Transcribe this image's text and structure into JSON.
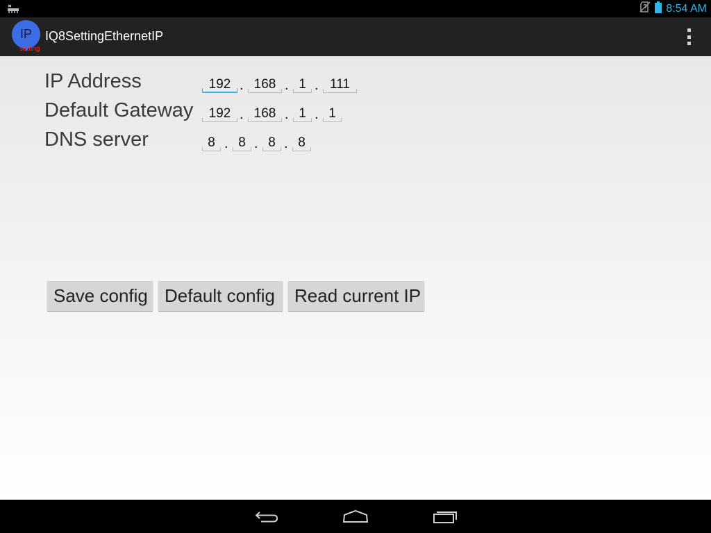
{
  "status_bar": {
    "time": "8:54 AM",
    "icons": [
      "usb-debug-icon",
      "no-sim-icon",
      "battery-icon"
    ]
  },
  "action_bar": {
    "icon_text": "IP",
    "icon_subtext": "setting",
    "title": "IQ8SettingEthernetIP",
    "overflow_icon": "overflow-menu-icon"
  },
  "form": {
    "ip_address": {
      "label": "IP Address",
      "octets": [
        "192",
        "168",
        "1",
        "111"
      ]
    },
    "default_gateway": {
      "label": "Default Gateway",
      "octets": [
        "192",
        "168",
        "1",
        "1"
      ]
    },
    "dns_server": {
      "label": "DNS server",
      "octets": [
        "8",
        "8",
        "8",
        "8"
      ]
    },
    "separator": "."
  },
  "buttons": {
    "save": "Save config",
    "default": "Default config",
    "read": "Read current IP"
  },
  "nav_bar": {
    "icons": [
      "back-icon",
      "home-icon",
      "recent-apps-icon"
    ]
  },
  "colors": {
    "accent": "#33b5e5",
    "app_icon": "#3a6de6"
  }
}
